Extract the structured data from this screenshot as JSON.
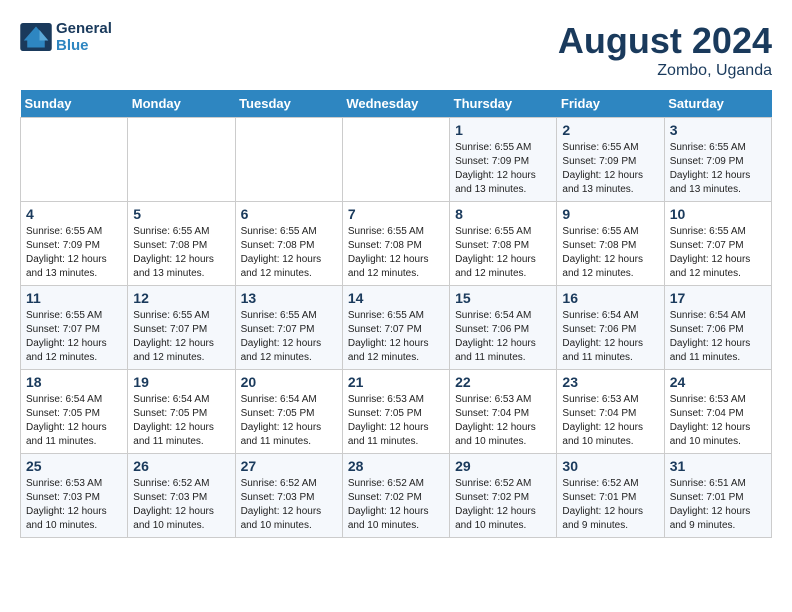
{
  "header": {
    "logo_line1": "General",
    "logo_line2": "Blue",
    "month_year": "August 2024",
    "location": "Zombo, Uganda"
  },
  "weekdays": [
    "Sunday",
    "Monday",
    "Tuesday",
    "Wednesday",
    "Thursday",
    "Friday",
    "Saturday"
  ],
  "weeks": [
    {
      "days": [
        {
          "num": "",
          "info": ""
        },
        {
          "num": "",
          "info": ""
        },
        {
          "num": "",
          "info": ""
        },
        {
          "num": "",
          "info": ""
        },
        {
          "num": "1",
          "info": "Sunrise: 6:55 AM\nSunset: 7:09 PM\nDaylight: 12 hours\nand 13 minutes."
        },
        {
          "num": "2",
          "info": "Sunrise: 6:55 AM\nSunset: 7:09 PM\nDaylight: 12 hours\nand 13 minutes."
        },
        {
          "num": "3",
          "info": "Sunrise: 6:55 AM\nSunset: 7:09 PM\nDaylight: 12 hours\nand 13 minutes."
        }
      ]
    },
    {
      "days": [
        {
          "num": "4",
          "info": "Sunrise: 6:55 AM\nSunset: 7:09 PM\nDaylight: 12 hours\nand 13 minutes."
        },
        {
          "num": "5",
          "info": "Sunrise: 6:55 AM\nSunset: 7:08 PM\nDaylight: 12 hours\nand 13 minutes."
        },
        {
          "num": "6",
          "info": "Sunrise: 6:55 AM\nSunset: 7:08 PM\nDaylight: 12 hours\nand 12 minutes."
        },
        {
          "num": "7",
          "info": "Sunrise: 6:55 AM\nSunset: 7:08 PM\nDaylight: 12 hours\nand 12 minutes."
        },
        {
          "num": "8",
          "info": "Sunrise: 6:55 AM\nSunset: 7:08 PM\nDaylight: 12 hours\nand 12 minutes."
        },
        {
          "num": "9",
          "info": "Sunrise: 6:55 AM\nSunset: 7:08 PM\nDaylight: 12 hours\nand 12 minutes."
        },
        {
          "num": "10",
          "info": "Sunrise: 6:55 AM\nSunset: 7:07 PM\nDaylight: 12 hours\nand 12 minutes."
        }
      ]
    },
    {
      "days": [
        {
          "num": "11",
          "info": "Sunrise: 6:55 AM\nSunset: 7:07 PM\nDaylight: 12 hours\nand 12 minutes."
        },
        {
          "num": "12",
          "info": "Sunrise: 6:55 AM\nSunset: 7:07 PM\nDaylight: 12 hours\nand 12 minutes."
        },
        {
          "num": "13",
          "info": "Sunrise: 6:55 AM\nSunset: 7:07 PM\nDaylight: 12 hours\nand 12 minutes."
        },
        {
          "num": "14",
          "info": "Sunrise: 6:55 AM\nSunset: 7:07 PM\nDaylight: 12 hours\nand 12 minutes."
        },
        {
          "num": "15",
          "info": "Sunrise: 6:54 AM\nSunset: 7:06 PM\nDaylight: 12 hours\nand 11 minutes."
        },
        {
          "num": "16",
          "info": "Sunrise: 6:54 AM\nSunset: 7:06 PM\nDaylight: 12 hours\nand 11 minutes."
        },
        {
          "num": "17",
          "info": "Sunrise: 6:54 AM\nSunset: 7:06 PM\nDaylight: 12 hours\nand 11 minutes."
        }
      ]
    },
    {
      "days": [
        {
          "num": "18",
          "info": "Sunrise: 6:54 AM\nSunset: 7:05 PM\nDaylight: 12 hours\nand 11 minutes."
        },
        {
          "num": "19",
          "info": "Sunrise: 6:54 AM\nSunset: 7:05 PM\nDaylight: 12 hours\nand 11 minutes."
        },
        {
          "num": "20",
          "info": "Sunrise: 6:54 AM\nSunset: 7:05 PM\nDaylight: 12 hours\nand 11 minutes."
        },
        {
          "num": "21",
          "info": "Sunrise: 6:53 AM\nSunset: 7:05 PM\nDaylight: 12 hours\nand 11 minutes."
        },
        {
          "num": "22",
          "info": "Sunrise: 6:53 AM\nSunset: 7:04 PM\nDaylight: 12 hours\nand 10 minutes."
        },
        {
          "num": "23",
          "info": "Sunrise: 6:53 AM\nSunset: 7:04 PM\nDaylight: 12 hours\nand 10 minutes."
        },
        {
          "num": "24",
          "info": "Sunrise: 6:53 AM\nSunset: 7:04 PM\nDaylight: 12 hours\nand 10 minutes."
        }
      ]
    },
    {
      "days": [
        {
          "num": "25",
          "info": "Sunrise: 6:53 AM\nSunset: 7:03 PM\nDaylight: 12 hours\nand 10 minutes."
        },
        {
          "num": "26",
          "info": "Sunrise: 6:52 AM\nSunset: 7:03 PM\nDaylight: 12 hours\nand 10 minutes."
        },
        {
          "num": "27",
          "info": "Sunrise: 6:52 AM\nSunset: 7:03 PM\nDaylight: 12 hours\nand 10 minutes."
        },
        {
          "num": "28",
          "info": "Sunrise: 6:52 AM\nSunset: 7:02 PM\nDaylight: 12 hours\nand 10 minutes."
        },
        {
          "num": "29",
          "info": "Sunrise: 6:52 AM\nSunset: 7:02 PM\nDaylight: 12 hours\nand 10 minutes."
        },
        {
          "num": "30",
          "info": "Sunrise: 6:52 AM\nSunset: 7:01 PM\nDaylight: 12 hours\nand 9 minutes."
        },
        {
          "num": "31",
          "info": "Sunrise: 6:51 AM\nSunset: 7:01 PM\nDaylight: 12 hours\nand 9 minutes."
        }
      ]
    }
  ]
}
